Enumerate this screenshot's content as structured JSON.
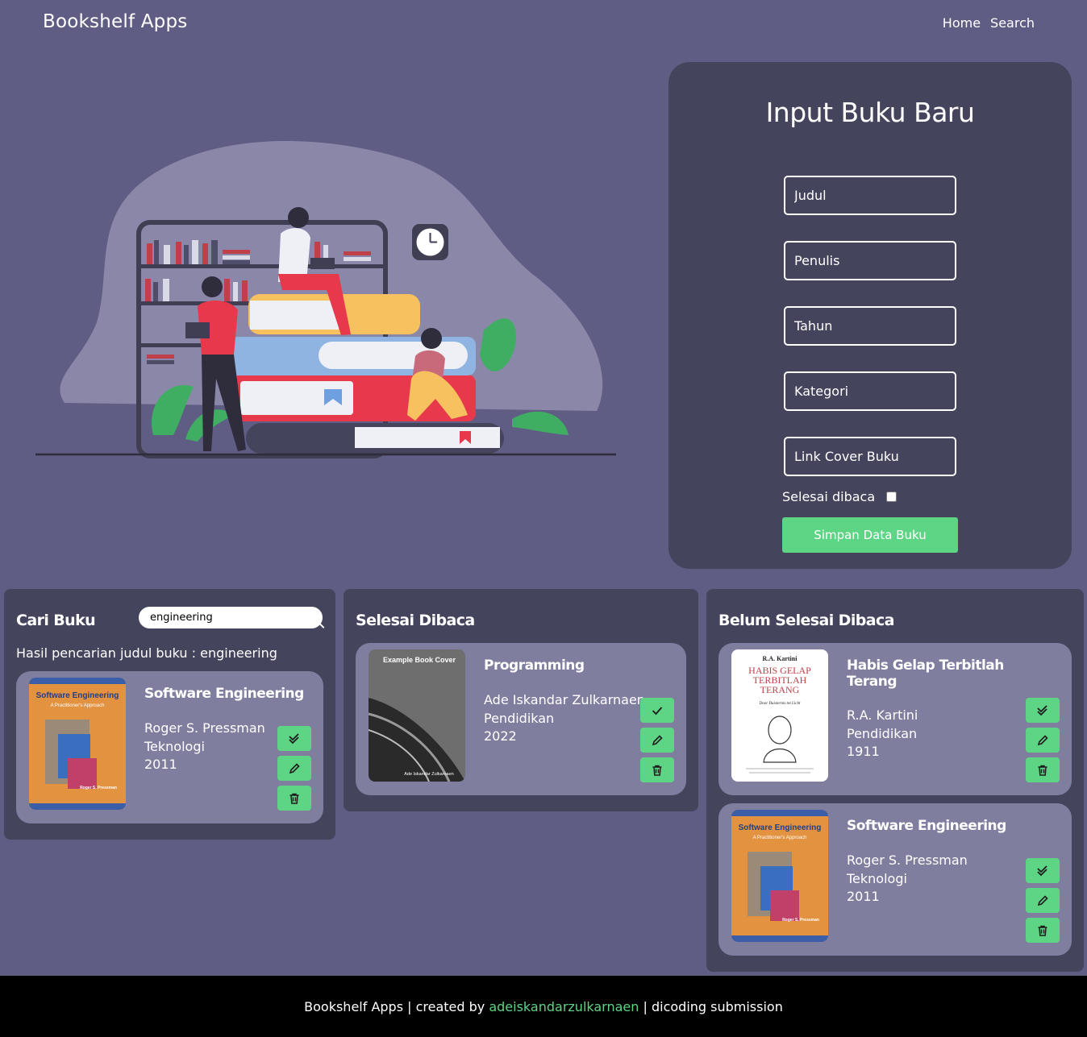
{
  "header": {
    "brand": "Bookshelf Apps",
    "nav": [
      "Home",
      "Search"
    ]
  },
  "form": {
    "title": "Input Buku Baru",
    "placeholders": {
      "judul": "Judul",
      "penulis": "Penulis",
      "tahun": "Tahun",
      "kategori": "Kategori",
      "cover": "Link Cover Buku"
    },
    "checkbox_label": "Selesai dibaca",
    "checkbox_checked": false,
    "submit_label": "Simpan Data Buku"
  },
  "search": {
    "title": "Cari Buku",
    "query": "engineering",
    "result_label": "Hasil pencarian judul buku : engineering",
    "results": [
      {
        "title": "Software Engineering",
        "author": "Roger S. Pressman",
        "category": "Teknologi",
        "year": "2011",
        "cover_title": "Software Engineering",
        "cover_subtitle": "A Practitioner's Approach",
        "cover_author": "Roger S. Pressman"
      }
    ]
  },
  "done": {
    "title": "Selesai Dibaca",
    "books": [
      {
        "title": "Programming",
        "author": "Ade Iskandar Zulkarnaen",
        "category": "Pendidikan",
        "year": "2022",
        "cover_title": "Example Book Cover",
        "cover_author": "Ade Iskandar Zulkarnaen"
      }
    ]
  },
  "undone": {
    "title": "Belum Selesai Dibaca",
    "books": [
      {
        "title": "Habis Gelap Terbitlah Terang",
        "author": "R.A. Kartini",
        "category": "Pendidikan",
        "year": "1911",
        "cover_author": "R.A. Kartini",
        "cover_title": "HABIS GELAP TERBITLAH TERANG",
        "cover_subtitle": "Door Duisternis tot Licht"
      },
      {
        "title": "Software Engineering",
        "author": "Roger S. Pressman",
        "category": "Teknologi",
        "year": "2011",
        "cover_title": "Software Engineering",
        "cover_subtitle": "A Practitioner's Approach",
        "cover_author": "Roger S. Pressman"
      }
    ]
  },
  "footer": {
    "prefix": "Bookshelf Apps | created by ",
    "link": "adeiskandarzulkarnaen",
    "suffix": " | dicoding submission"
  },
  "colors": {
    "background": "#5f5d84",
    "panel": "#45445d",
    "card": "#807e9f",
    "accent": "#5ed485",
    "footer": "#000000"
  },
  "icons": {
    "done": "check-double-icon",
    "undone": "check-icon",
    "edit": "pencil-icon",
    "delete": "trash-icon",
    "search": "search-icon"
  }
}
